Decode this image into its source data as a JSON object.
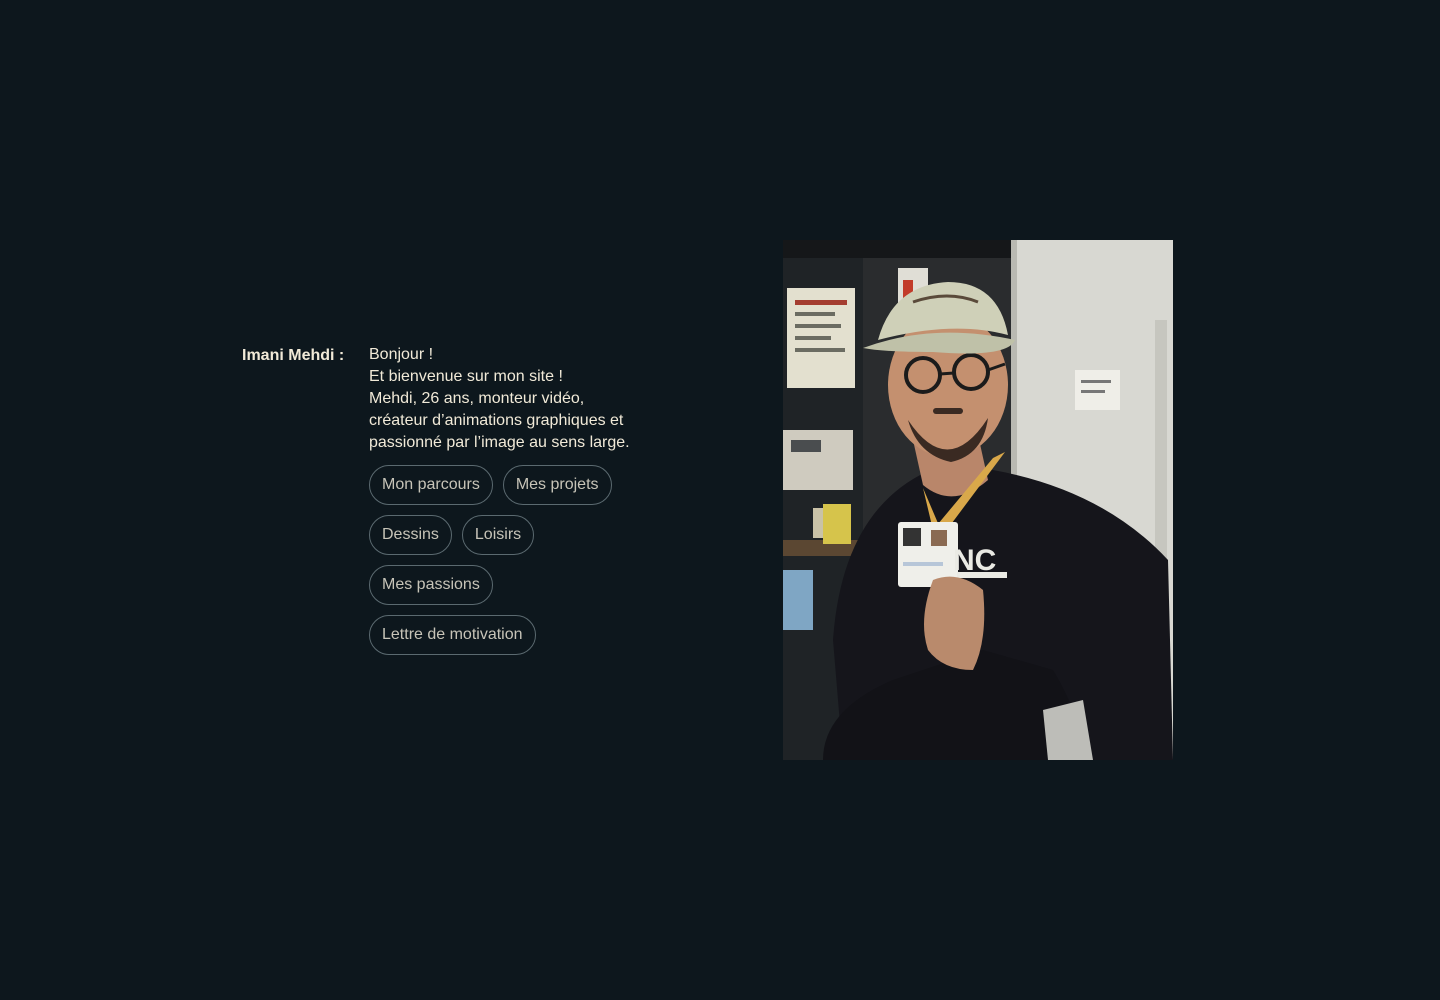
{
  "profile": {
    "name_label": "Imani Mehdi :",
    "greeting": "Bonjour !",
    "welcome": "Et bienvenue sur mon site !",
    "bio_line_1": "Mehdi, 26 ans, monteur vidéo,",
    "bio_line_2": "créateur d’animations graphiques et",
    "bio_line_3": "passionné par l’image au sens large."
  },
  "nav": {
    "parcours": "Mon parcours",
    "projets": "Mes projets",
    "dessins": "Dessins",
    "loisirs": "Loisirs",
    "passions": "Mes passions",
    "lettre": "Lettre de motivation"
  },
  "colors": {
    "background": "#0d171d",
    "text": "#f1ead8",
    "button_border": "#5b6a70",
    "button_text": "#c7c4b8"
  }
}
